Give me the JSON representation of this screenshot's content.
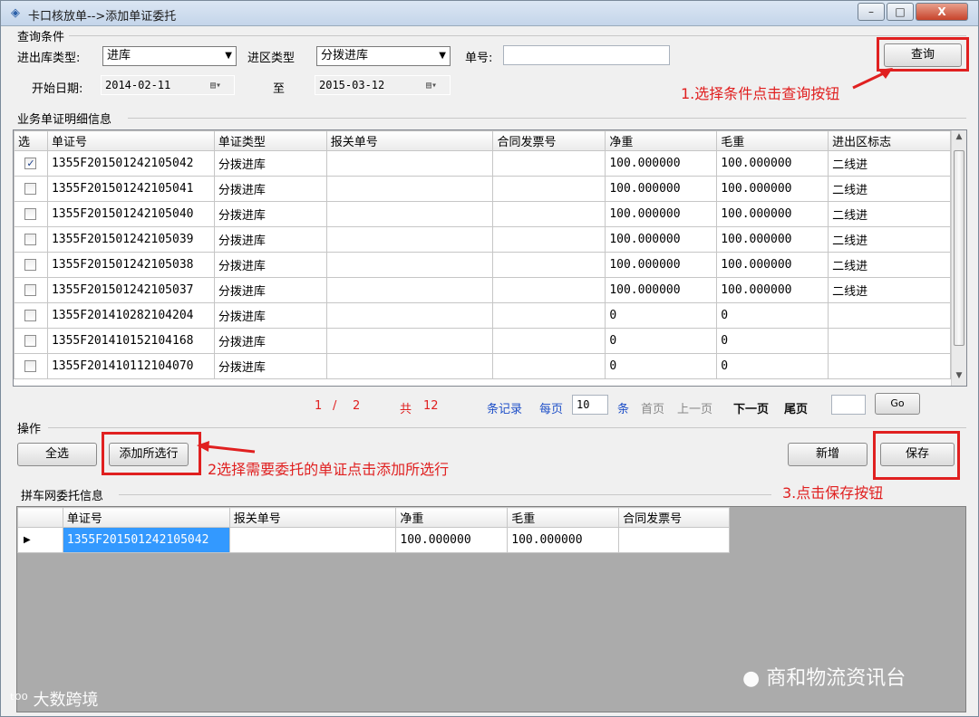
{
  "window": {
    "title": "卡口核放单-->添加单证委托",
    "minimize": "–",
    "maximize": "□",
    "close": "X"
  },
  "query": {
    "group_label": "查询条件",
    "io_type_label": "进出库类型:",
    "io_type_value": "进库",
    "zone_type_label": "进区类型",
    "zone_type_value": "分拨进库",
    "doc_no_label": "单号:",
    "doc_no_value": "",
    "start_date_label": "开始日期:",
    "start_date": "2014-02-11",
    "to_label": "至",
    "end_date": "2015-03-12",
    "search_button": "查询"
  },
  "detail": {
    "group_label": "业务单证明细信息",
    "columns": [
      "选",
      "单证号",
      "单证类型",
      "报关单号",
      "合同发票号",
      "净重",
      "毛重",
      "进出区标志"
    ],
    "rows": [
      {
        "checked": "✓",
        "doc_no": "1355F201501242105042",
        "type": "分拨进库",
        "customs_no": "",
        "invoice": "",
        "net": "100.000000",
        "gross": "100.000000",
        "flag": "二线进"
      },
      {
        "checked": "",
        "doc_no": "1355F201501242105041",
        "type": "分拨进库",
        "customs_no": "",
        "invoice": "",
        "net": "100.000000",
        "gross": "100.000000",
        "flag": "二线进"
      },
      {
        "checked": "",
        "doc_no": "1355F201501242105040",
        "type": "分拨进库",
        "customs_no": "",
        "invoice": "",
        "net": "100.000000",
        "gross": "100.000000",
        "flag": "二线进"
      },
      {
        "checked": "",
        "doc_no": "1355F201501242105039",
        "type": "分拨进库",
        "customs_no": "",
        "invoice": "",
        "net": "100.000000",
        "gross": "100.000000",
        "flag": "二线进"
      },
      {
        "checked": "",
        "doc_no": "1355F201501242105038",
        "type": "分拨进库",
        "customs_no": "",
        "invoice": "",
        "net": "100.000000",
        "gross": "100.000000",
        "flag": "二线进"
      },
      {
        "checked": "",
        "doc_no": "1355F201501242105037",
        "type": "分拨进库",
        "customs_no": "",
        "invoice": "",
        "net": "100.000000",
        "gross": "100.000000",
        "flag": "二线进"
      },
      {
        "checked": "",
        "doc_no": "1355F201410282104204",
        "type": "分拨进库",
        "customs_no": "",
        "invoice": "",
        "net": "0",
        "gross": "0",
        "flag": ""
      },
      {
        "checked": "",
        "doc_no": "1355F201410152104168",
        "type": "分拨进库",
        "customs_no": "",
        "invoice": "",
        "net": "0",
        "gross": "0",
        "flag": ""
      },
      {
        "checked": "",
        "doc_no": "1355F201410112104070",
        "type": "分拨进库",
        "customs_no": "",
        "invoice": "",
        "net": "0",
        "gross": "0",
        "flag": ""
      }
    ]
  },
  "pager": {
    "current": "1",
    "sep": "/",
    "total_pages": "2",
    "total_label": "共",
    "total_records": "12",
    "records_label": "条记录",
    "per_page_label": "每页",
    "per_page": "10",
    "unit_label": "条",
    "first": "首页",
    "prev": "上一页",
    "next": "下一页",
    "last": "尾页",
    "goto_value": "",
    "go": "Go"
  },
  "ops": {
    "group_label": "操作",
    "select_all": "全选",
    "add_selected": "添加所选行",
    "new": "新增",
    "save": "保存"
  },
  "annotations": {
    "step1": "1.选择条件点击查询按钮",
    "step2": "2选择需要委托的单证点击添加所选行",
    "step3": "3.点击保存按钮"
  },
  "delegation": {
    "group_label": "拼车网委托信息",
    "columns": [
      "单证号",
      "报关单号",
      "净重",
      "毛重",
      "合同发票号"
    ],
    "row": {
      "pointer": "▶",
      "doc_no": "1355F201501242105042",
      "customs_no": "",
      "net": "100.000000",
      "gross": "100.000000",
      "invoice": ""
    }
  },
  "watermarks": {
    "left": "大数跨境",
    "right": "商和物流资讯台"
  },
  "colors": {
    "annotation_red": "#e02020",
    "selection_blue": "#3399ff",
    "pager_red": "#e02020",
    "pager_blue": "#1e4fc8"
  }
}
